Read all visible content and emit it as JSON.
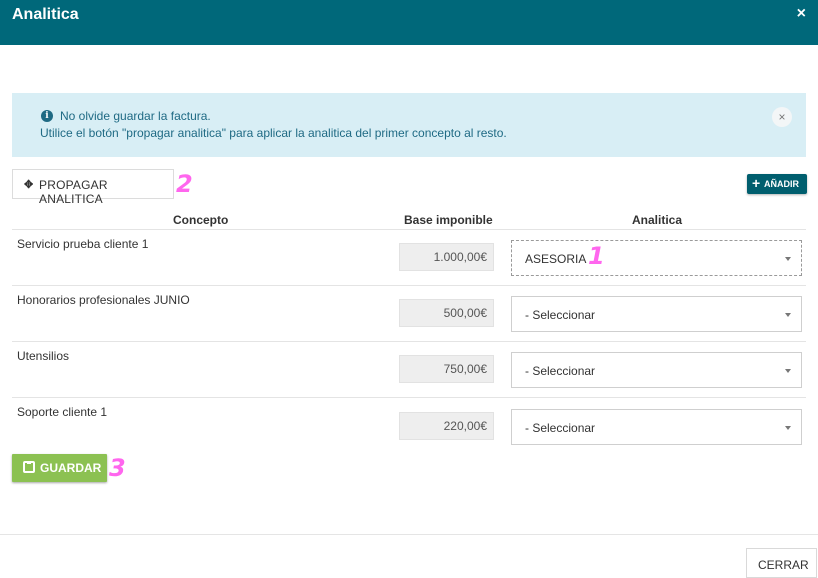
{
  "dialog": {
    "title": "Analitica",
    "close_symbol": "×"
  },
  "alert": {
    "icon": "info-icon",
    "line1": "No olvide guardar la factura.",
    "line2": "Utilice el botón \"propagar analitica\" para aplicar la analitica del primer concepto al resto.",
    "dismiss_symbol": "×"
  },
  "toolbar": {
    "propagar_label": "PROPAGAR ANALITICA",
    "anadir_label": "AÑADIR"
  },
  "annotations": [
    "1",
    "2",
    "3"
  ],
  "table": {
    "headers": [
      "Concepto",
      "Base imponible",
      "Analitica"
    ],
    "rows": [
      {
        "concepto": "Servicio prueba cliente 1",
        "base": "1.000,00€",
        "analitica": "ASESORIA"
      },
      {
        "concepto": "Honorarios profesionales JUNIO",
        "base": "500,00€",
        "analitica": "- Seleccionar"
      },
      {
        "concepto": "Utensilios",
        "base": "750,00€",
        "analitica": "- Seleccionar"
      },
      {
        "concepto": "Soporte cliente 1",
        "base": "220,00€",
        "analitica": "- Seleccionar"
      }
    ]
  },
  "actions": {
    "guardar_label": "GUARDAR",
    "cerrar_label": "CERRAR"
  },
  "colors": {
    "header": "#00687a",
    "alert_bg": "#d8eef5",
    "guardar": "#8cc152",
    "anadir": "#005e6e",
    "annotation": "#ff66ee"
  }
}
